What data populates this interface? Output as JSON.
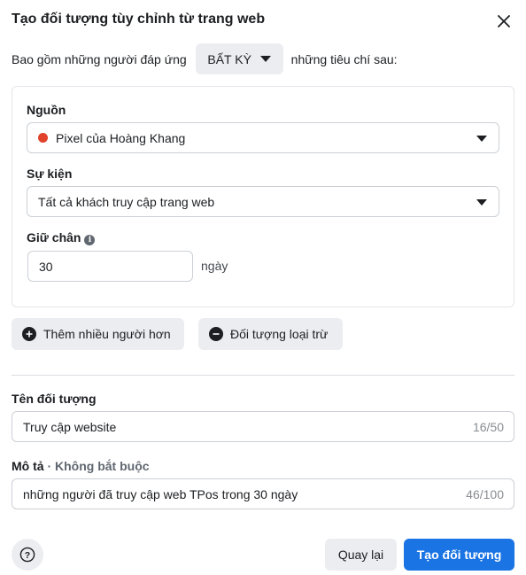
{
  "dialog": {
    "title": "Tạo đối tượng tùy chỉnh từ trang web"
  },
  "include": {
    "prefix": "Bao gồm những người đáp ứng",
    "match_mode": "BẤT KỲ",
    "suffix": "những tiêu chí sau:"
  },
  "source": {
    "label": "Nguồn",
    "value": "Pixel của Hoàng Khang",
    "status_color": "#e0422b"
  },
  "event": {
    "label": "Sự kiện",
    "value": "Tất cả khách truy cập trang web"
  },
  "retention": {
    "label": "Giữ chân",
    "value": "30",
    "unit": "ngày",
    "info_icon": "i"
  },
  "actions": {
    "include_more": "Thêm nhiều người hơn",
    "exclude": "Đối tượng loại trừ"
  },
  "audience_name": {
    "label": "Tên đối tượng",
    "value": "Truy cập website",
    "counter": "16/50"
  },
  "description": {
    "label": "Mô tả",
    "optional": " · Không bắt buộc",
    "value": "những người đã truy cập web TPos trong 30 ngày",
    "counter": "46/100"
  },
  "footer": {
    "help_icon": "?",
    "back_label": "Quay lại",
    "create_label": "Tạo đối tượng"
  },
  "colors": {
    "primary": "#1b74e4",
    "secondary_bg": "#ebedf0"
  }
}
